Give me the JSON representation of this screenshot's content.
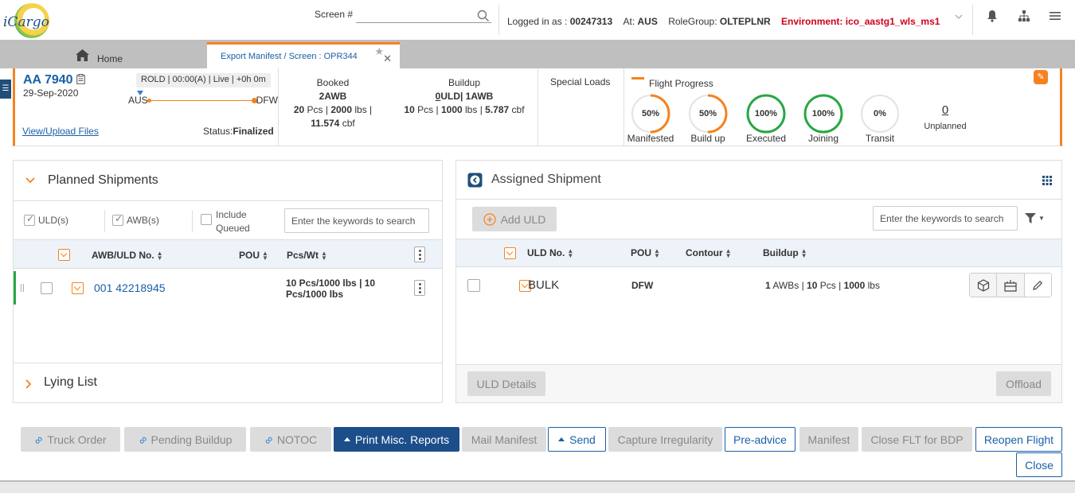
{
  "header": {
    "logo": "iCargo",
    "screen_label": "Screen #",
    "screen_value": "",
    "logged_in_label": "Logged in as :",
    "user": "00247313",
    "at_label": "At:",
    "station": "AUS",
    "rolegroup_label": "RoleGroup:",
    "rolegroup": "OLTEPLNR",
    "environment": "Environment: ico_aastg1_wls_ms1"
  },
  "tabs": {
    "home": "Home",
    "active": "Export Manifest / Screen : OPR344"
  },
  "flight": {
    "number": "AA 7940",
    "date": "29-Sep-2020",
    "status_chip": "ROLD | 00:00(A) | Live | +0h 0m",
    "origin": "AUS",
    "destination": "DFW",
    "view_files": "View/Upload Files",
    "status_label": "Status:",
    "status": "Finalized",
    "booked": {
      "label": "Booked",
      "awb": "2AWB",
      "pcs": "20",
      "pcs_unit": "Pcs",
      "wt": "2000",
      "wt_unit": "lbs",
      "vol": "11.574",
      "vol_unit": "cbf"
    },
    "buildup": {
      "label": "Buildup",
      "uld_count": "0",
      "uld_rest": "ULD| 1AWB",
      "pcs": "10",
      "pcs_unit": "Pcs",
      "wt": "1000",
      "wt_unit": "lbs",
      "vol": "5.787",
      "vol_unit": "cbf"
    },
    "special_loads": "Special Loads",
    "progress": {
      "title": "Flight Progress",
      "items": [
        {
          "value": "50%",
          "label": "Manifested",
          "pct": 50,
          "color": "#f58220"
        },
        {
          "value": "50%",
          "label": "Build up",
          "pct": 50,
          "color": "#f58220"
        },
        {
          "value": "100%",
          "label": "Executed",
          "pct": 100,
          "color": "#28a745"
        },
        {
          "value": "100%",
          "label": "Joining",
          "pct": 100,
          "color": "#28a745"
        },
        {
          "value": "0%",
          "label": "Transit",
          "pct": 0,
          "color": "#28a745"
        }
      ],
      "unplanned_count": "0",
      "unplanned_label": "Unplanned"
    }
  },
  "planned": {
    "title": "Planned Shipments",
    "filters": {
      "uld": "ULD(s)",
      "awb": "AWB(s)",
      "include_queued": "Include Queued"
    },
    "search_placeholder": "Enter the keywords to search",
    "columns": {
      "awb": "AWB/ULD No.",
      "pou": "POU",
      "pcswt": "Pcs/Wt"
    },
    "rows": [
      {
        "awb": "001 42218945",
        "pou": "",
        "pcswt": "10 Pcs/1000 lbs | 10 Pcs/1000 lbs"
      }
    ],
    "lying_list": "Lying List"
  },
  "assigned": {
    "title": "Assigned Shipment",
    "add_uld": "Add ULD",
    "search_placeholder": "Enter the keywords to search",
    "columns": {
      "uld": "ULD No.",
      "pou": "POU",
      "contour": "Contour",
      "buildup": "Buildup"
    },
    "rows": [
      {
        "uld": "BULK",
        "pou": "DFW",
        "contour": "",
        "awbs": "1",
        "awbs_unit": "AWBs |",
        "pcs": "10",
        "pcs_unit": "Pcs |",
        "wt": "1000",
        "wt_unit": "lbs"
      }
    ],
    "uld_details": "ULD Details",
    "offload": "Offload"
  },
  "footer": {
    "truck_order": "Truck Order",
    "pending_buildup": "Pending Buildup",
    "notoc": "NOTOC",
    "print_misc": "Print Misc. Reports",
    "mail_manifest": "Mail Manifest",
    "send": "Send",
    "capture_irregularity": "Capture Irregularity",
    "pre_advice": "Pre-advice",
    "manifest": "Manifest",
    "close_flt": "Close FLT for BDP",
    "reopen_flight": "Reopen Flight",
    "close": "Close"
  },
  "colors": {
    "accent": "#f58220",
    "link": "#1a5fa8",
    "primary_button": "#1c4e8a",
    "env": "#d0021b",
    "success": "#28a745"
  }
}
